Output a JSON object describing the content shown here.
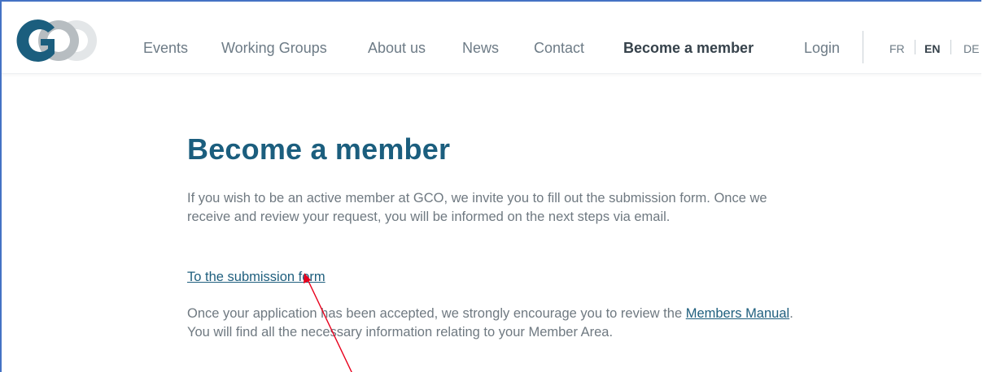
{
  "header": {
    "logo_icon": "gco-logo-icon",
    "nav": [
      {
        "label": "Events"
      },
      {
        "label": "Working Groups"
      },
      {
        "label": "About us"
      },
      {
        "label": "News"
      },
      {
        "label": "Contact"
      },
      {
        "label": "Become a member",
        "active": true
      },
      {
        "label": "Login"
      }
    ],
    "languages": [
      {
        "code": "FR"
      },
      {
        "code": "EN",
        "active": true
      },
      {
        "code": "DE"
      }
    ]
  },
  "main": {
    "title": "Become a member",
    "intro": "If you wish to be an active member at GCO, we invite you to fill out the submission form. Once we receive and review your request, you will be informed on the next steps via email.",
    "submission_link": "To the submission form",
    "manual_before": "Once your application has been accepted, we strongly encourage you to review the ",
    "manual_link": "Members Manual",
    "manual_after": ". You will find all the necessary information relating to your Member Area."
  },
  "colors": {
    "brand": "#1b5e7e",
    "frame_border": "#4472c4",
    "annotation_arrow": "#e8001c"
  }
}
